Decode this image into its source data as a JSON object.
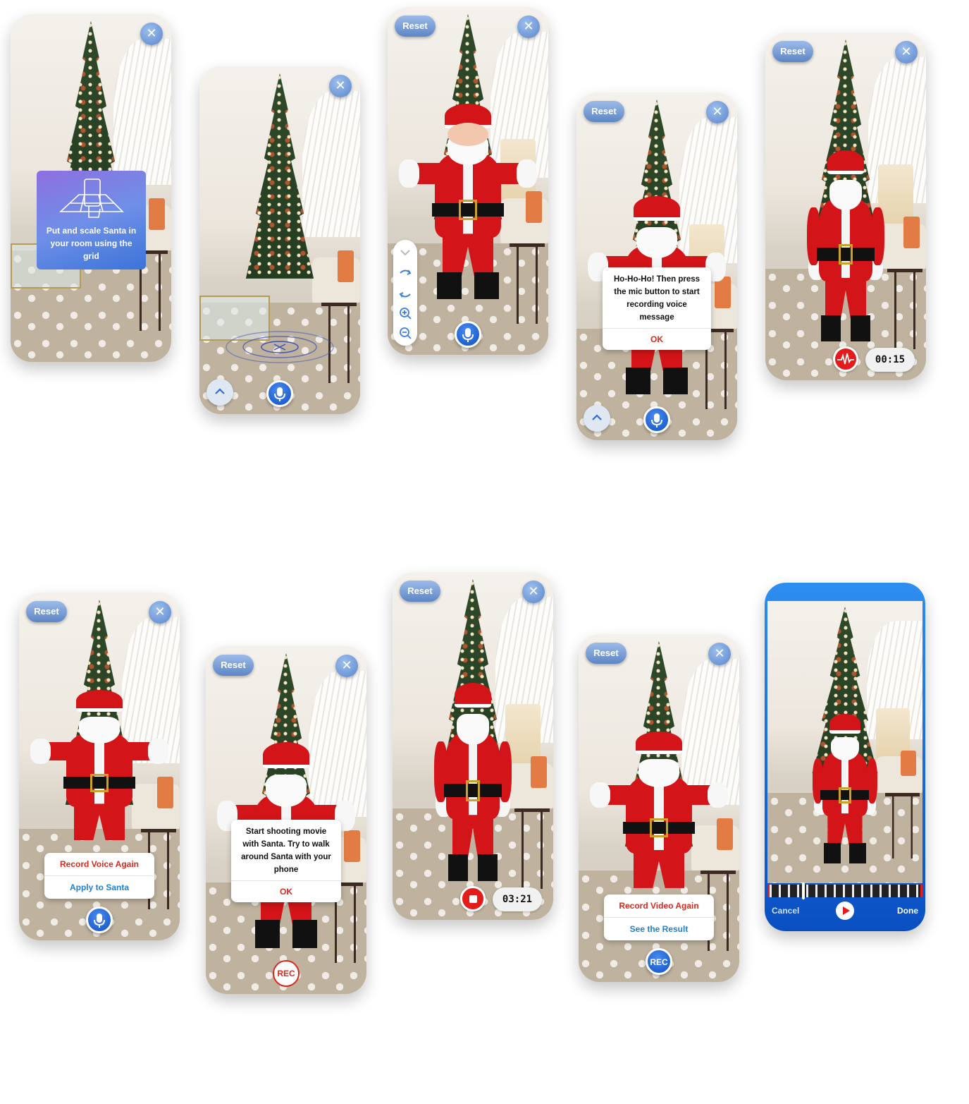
{
  "screens": {
    "s1": {
      "hint": "Put and scale Santa in your room using the grid"
    },
    "reset_label": "Reset",
    "s4": {
      "message": "Ho-Ho-Ho! Then press the mic button to start recording voice message",
      "ok": "OK"
    },
    "s5": {
      "timer": "00:15"
    },
    "s6": {
      "option1": "Record Voice Again",
      "option2": "Apply to Santa"
    },
    "s7": {
      "message": "Start shooting movie with Santa. Try to walk around Santa with your phone",
      "ok": "OK",
      "rec": "REC"
    },
    "s8": {
      "timer": "03:21"
    },
    "s9": {
      "option1": "Record Video Again",
      "option2": "See the Result",
      "rec": "REC"
    },
    "s10": {
      "cancel": "Cancel",
      "done": "Done"
    }
  },
  "icons": [
    "close-icon",
    "mic-icon",
    "chevron-up-icon",
    "chevron-down-icon",
    "rotate-right-icon",
    "rotate-left-icon",
    "zoom-in-icon",
    "zoom-out-icon",
    "waveform-icon",
    "stop-icon",
    "play-icon",
    "phone-grid-icon"
  ],
  "colors": {
    "accent_blue": "#1467d9",
    "alert_red": "#d62a1e",
    "santa_red": "#d31418"
  }
}
